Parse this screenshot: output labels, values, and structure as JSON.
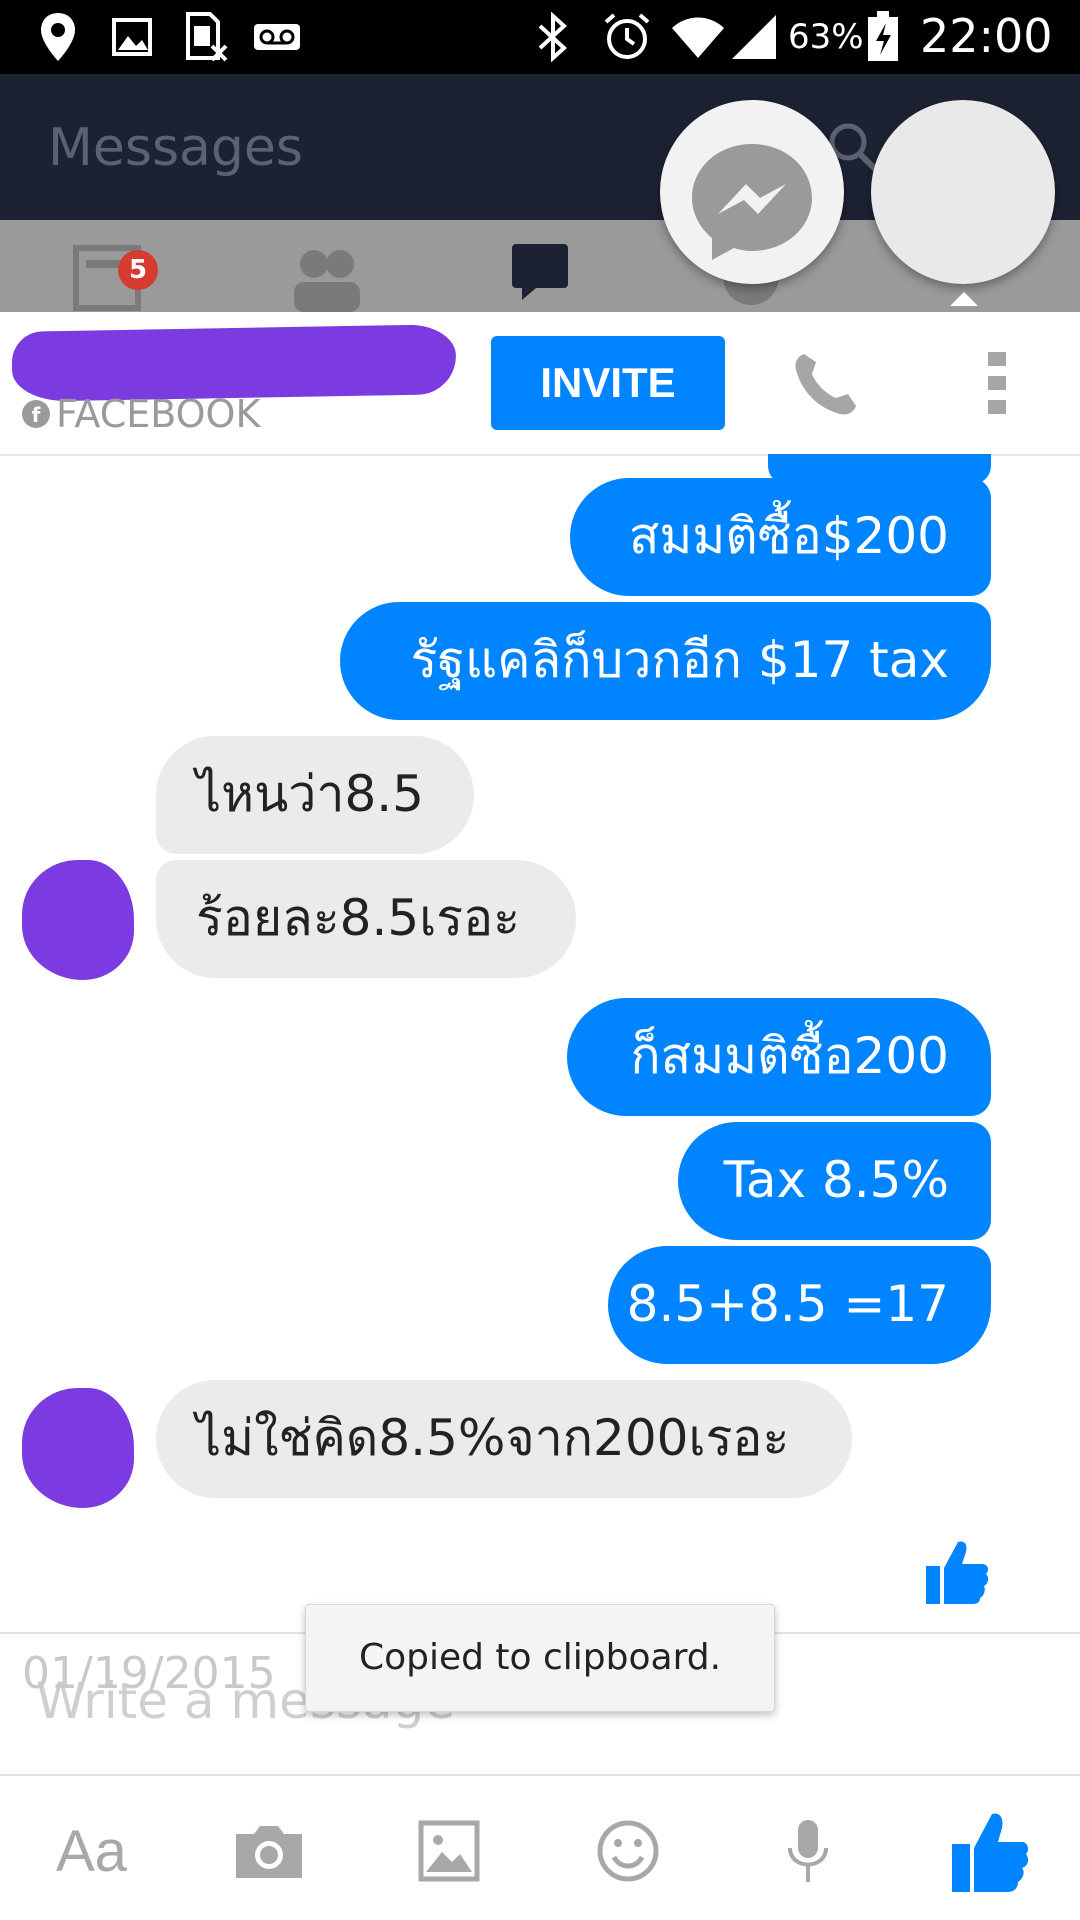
{
  "status_bar": {
    "battery": "63%",
    "time": "22:00",
    "icons": [
      "location-icon",
      "image-icon",
      "sim-icon",
      "voicemail-icon",
      "bluetooth-icon",
      "alarm-icon",
      "wifi-icon",
      "signal-icon",
      "battery-icon"
    ]
  },
  "background_app": {
    "title": "Messages",
    "badge_count": "5"
  },
  "chat_header": {
    "source_label": "FACEBOOK",
    "invite_label": "INVITE"
  },
  "messages": [
    {
      "side": "out",
      "text": "สมมติซื้อ$200"
    },
    {
      "side": "out",
      "text": "รัฐแคลิก็บวกอีก $17 tax"
    },
    {
      "side": "in",
      "text": "ไหนว่า8.5"
    },
    {
      "side": "in",
      "text": "ร้อยละ8.5เรอะ"
    },
    {
      "side": "out",
      "text": "ก็สมมติซื้อ200"
    },
    {
      "side": "out",
      "text": "Tax 8.5%"
    },
    {
      "side": "out",
      "text": "8.5+8.5 =17"
    },
    {
      "side": "in",
      "text": "ไม่ใช่คิด8.5%จาก200เรอะ"
    }
  ],
  "composer": {
    "placeholder": "Write a message",
    "timestamp": "01/19/2015",
    "font_toggle": "Aa"
  },
  "toast": "Copied to clipboard.",
  "colors": {
    "accent": "#0084ff",
    "incoming": "#ebebeb",
    "redaction": "#7b3be0"
  }
}
